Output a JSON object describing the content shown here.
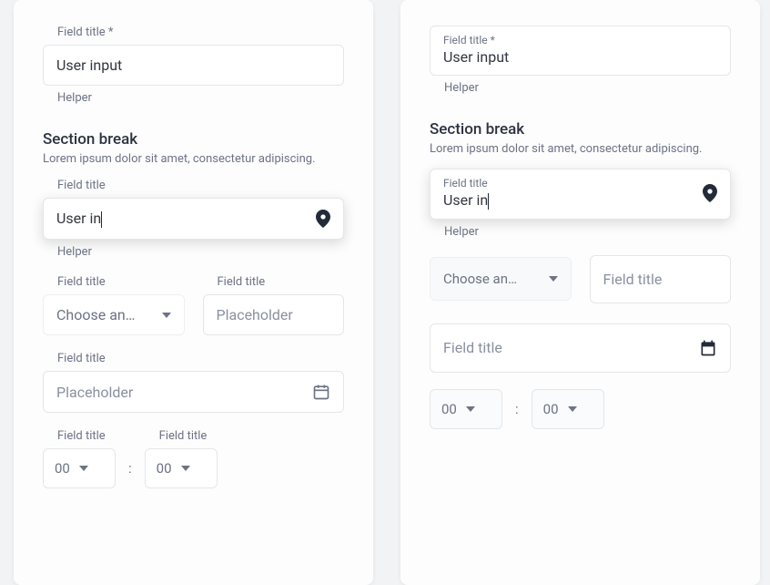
{
  "left": {
    "field1": {
      "label": "Field title *",
      "value": "User input",
      "helper": "Helper"
    },
    "section": {
      "title": "Section break",
      "desc": "Lorem ipsum dolor sit amet, consectetur adipiscing."
    },
    "field2": {
      "label": "Field title",
      "value": "User in",
      "helper": "Helper"
    },
    "dropdown": {
      "label": "Field title",
      "value": "Choose an…"
    },
    "field3": {
      "label": "Field title",
      "placeholder": "Placeholder"
    },
    "date": {
      "label": "Field title",
      "placeholder": "Placeholder"
    },
    "timeH": {
      "label": "Field title",
      "value": "00"
    },
    "timeM": {
      "label": "Field title",
      "value": "00"
    },
    "colon": ":"
  },
  "right": {
    "field1": {
      "label": "Field title *",
      "value": "User input",
      "helper": "Helper"
    },
    "section": {
      "title": "Section break",
      "desc": "Lorem ipsum dolor sit amet, consectetur adipiscing."
    },
    "field2": {
      "label": "Field title",
      "value": "User in",
      "helper": "Helper"
    },
    "dropdown": {
      "value": "Choose an…"
    },
    "field3": {
      "placeholder": "Field title"
    },
    "date": {
      "placeholder": "Field title"
    },
    "timeH": {
      "value": "00"
    },
    "timeM": {
      "value": "00"
    },
    "colon": ":"
  }
}
